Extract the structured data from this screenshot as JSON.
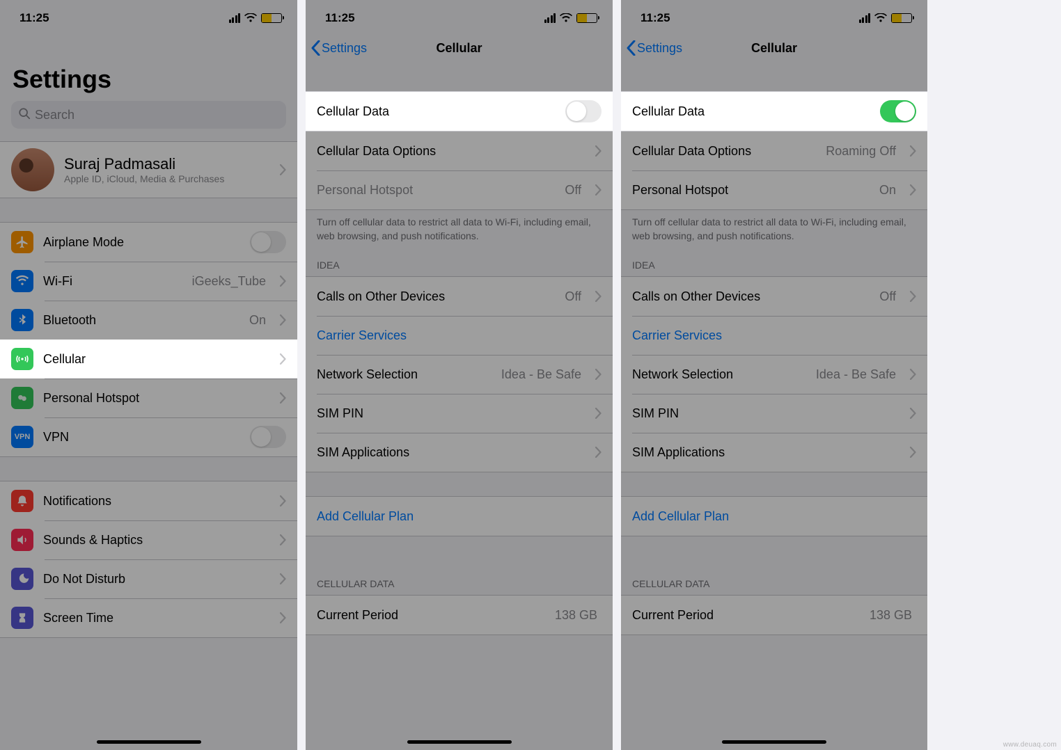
{
  "status": {
    "time": "11:25"
  },
  "screen1": {
    "title": "Settings",
    "search_placeholder": "Search",
    "profile": {
      "name": "Suraj Padmasali",
      "subtitle": "Apple ID, iCloud, Media & Purchases"
    },
    "rows_a": {
      "airplane": "Airplane Mode",
      "wifi": "Wi-Fi",
      "wifi_value": "iGeeks_Tube",
      "bluetooth": "Bluetooth",
      "bluetooth_value": "On",
      "cellular": "Cellular",
      "hotspot": "Personal Hotspot",
      "vpn": "VPN"
    },
    "rows_b": {
      "notifications": "Notifications",
      "sounds": "Sounds & Haptics",
      "dnd": "Do Not Disturb",
      "screentime": "Screen Time"
    }
  },
  "screen2": {
    "back": "Settings",
    "title": "Cellular",
    "cellular_data": "Cellular Data",
    "cell_data_on": false,
    "data_options": "Cellular Data Options",
    "data_options_value": "",
    "hotspot": "Personal Hotspot",
    "hotspot_value": "Off",
    "footer": "Turn off cellular data to restrict all data to Wi-Fi, including email, web browsing, and push notifications.",
    "carrier_header": "IDEA",
    "calls_other": "Calls on Other Devices",
    "calls_other_value": "Off",
    "carrier_services": "Carrier Services",
    "network_sel": "Network Selection",
    "network_sel_value": "Idea - Be Safe",
    "sim_pin": "SIM PIN",
    "sim_apps": "SIM Applications",
    "add_plan": "Add Cellular Plan",
    "usage_header": "CELLULAR DATA",
    "current_period": "Current Period",
    "current_period_value": "138 GB"
  },
  "screen3": {
    "back": "Settings",
    "title": "Cellular",
    "cellular_data": "Cellular Data",
    "cell_data_on": true,
    "data_options": "Cellular Data Options",
    "data_options_value": "Roaming Off",
    "hotspot": "Personal Hotspot",
    "hotspot_value": "On",
    "footer": "Turn off cellular data to restrict all data to Wi-Fi, including email, web browsing, and push notifications.",
    "carrier_header": "IDEA",
    "calls_other": "Calls on Other Devices",
    "calls_other_value": "Off",
    "carrier_services": "Carrier Services",
    "network_sel": "Network Selection",
    "network_sel_value": "Idea - Be Safe",
    "sim_pin": "SIM PIN",
    "sim_apps": "SIM Applications",
    "add_plan": "Add Cellular Plan",
    "usage_header": "CELLULAR DATA",
    "current_period": "Current Period",
    "current_period_value": "138 GB"
  },
  "watermark": "www.deuaq.com"
}
